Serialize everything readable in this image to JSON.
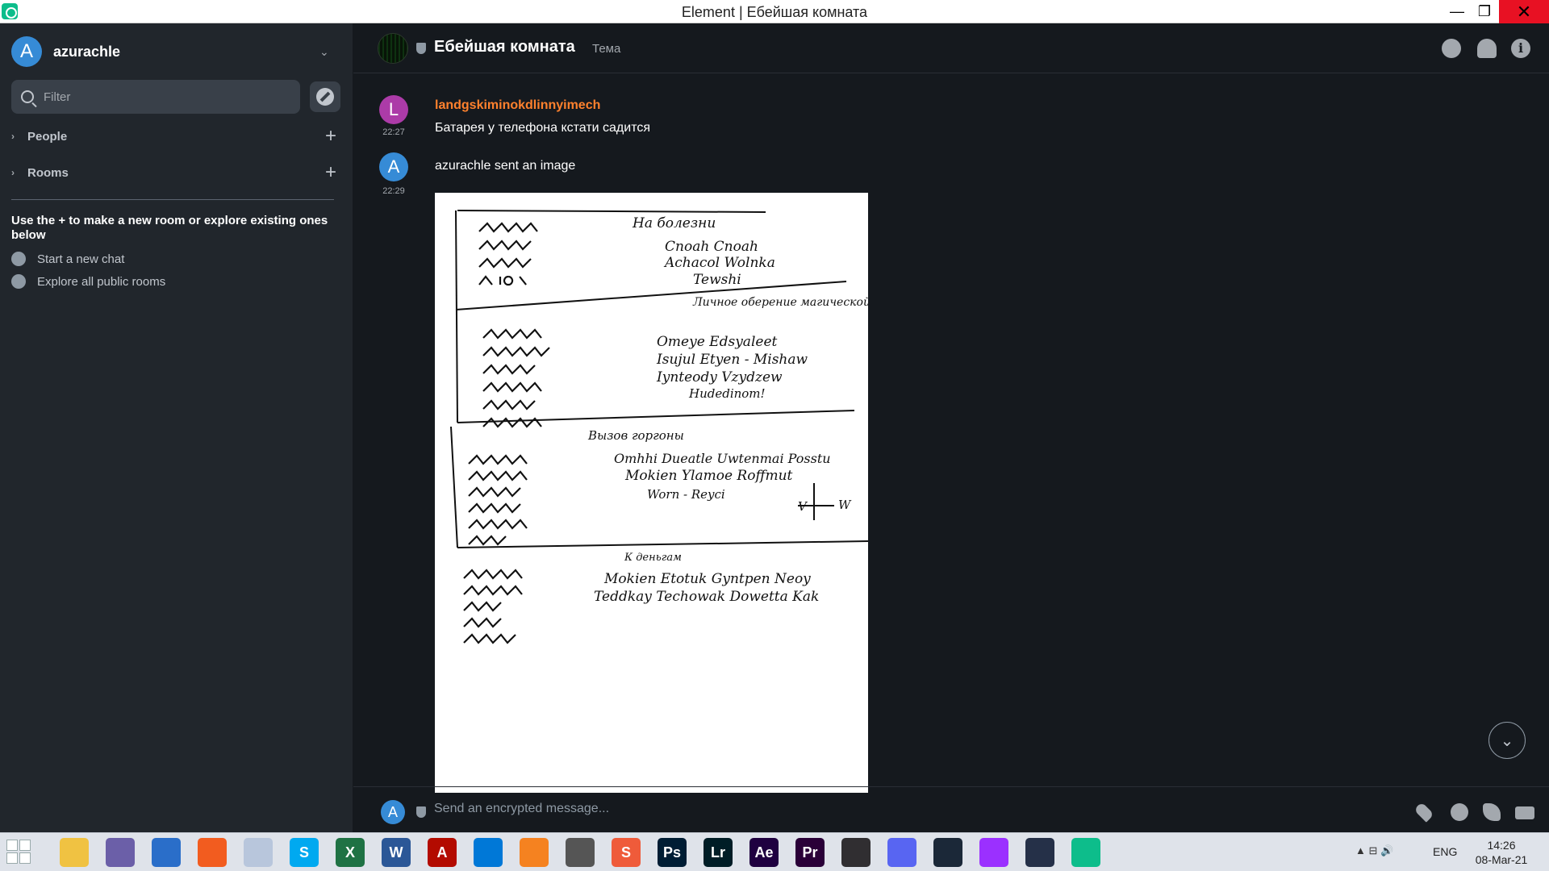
{
  "window": {
    "title": "Element | Ебейшая комната",
    "minimize_glyph": "—",
    "maximize_glyph": "❐",
    "close_glyph": "✕"
  },
  "sidebar": {
    "user": {
      "avatar_letter": "A",
      "name": "azurachle",
      "chevron": "⌄"
    },
    "filter": {
      "placeholder": "Filter",
      "value": ""
    },
    "sections": [
      {
        "label": "People",
        "chevron": "›",
        "add_glyph": "+"
      },
      {
        "label": "Rooms",
        "chevron": "›",
        "add_glyph": "+"
      }
    ],
    "hint": "Use the + to make a new room or explore existing ones below",
    "actions": [
      {
        "label": "Start a new chat",
        "icon": "chat-bubble-icon"
      },
      {
        "label": "Explore all public rooms",
        "icon": "compass-icon"
      }
    ]
  },
  "room": {
    "name": "Ебейшая комната",
    "topic": "Тема",
    "header_icons": [
      "search-icon",
      "bell-icon",
      "info-icon"
    ]
  },
  "messages": [
    {
      "avatar_letter": "L",
      "avatar_color": "#ac3ba8",
      "sender": "landgskiminokdlinnyimech",
      "sender_color": "#ff812d",
      "time": "22:27",
      "body": "Батарея у телефона кстати садится"
    },
    {
      "avatar_letter": "A",
      "avatar_color": "#368bd6",
      "time": "22:29",
      "emote": "azurachle sent an image"
    }
  ],
  "image_text": {
    "section1_title": "На болезни",
    "section1_lines": [
      "Cnoah   Cnoah",
      "Achacol  Wolnka",
      "Tewshi"
    ],
    "section2_title": "Личное оберение магической силы",
    "section2_lines": [
      "Omeye   Edsyaleet",
      "Isujul   Etyen - Mishaw",
      "Iynteody  Vzydzew",
      "Hudedinom!"
    ],
    "section3_title": "Вызов горгоны",
    "section3_lines": [
      "Omhhi   Dueatle   Uwtenmai  Posstu",
      "Mokien   Ylamoe   Roffmut",
      "Worn - Reyci"
    ],
    "section4_title": "К деньгам",
    "section4_lines": [
      "Mokien  Etotuk   Gyntpen  Neoy",
      "Teddkay  Techowak  Dowetta  Kak"
    ],
    "compass_labels": [
      "V",
      "W"
    ]
  },
  "scroll_button": {
    "glyph": "⌄"
  },
  "composer": {
    "avatar_letter": "A",
    "placeholder": "Send an encrypted message...",
    "icons": [
      "attach-icon",
      "emoji-icon",
      "voice-call-icon",
      "video-call-icon"
    ]
  },
  "taskbar": {
    "apps": [
      {
        "name": "file-explorer",
        "label": "",
        "color": "#f0c242"
      },
      {
        "name": "bittorrent",
        "label": "",
        "color": "#6b5fa8"
      },
      {
        "name": "browser",
        "label": "",
        "color": "#2a6ec9"
      },
      {
        "name": "firefox",
        "label": "",
        "color": "#f25c1f"
      },
      {
        "name": "globe",
        "label": "",
        "color": "#b8c6dc"
      },
      {
        "name": "skype",
        "label": "S",
        "color": "#00a9f0"
      },
      {
        "name": "excel",
        "label": "X",
        "color": "#1f7244"
      },
      {
        "name": "word",
        "label": "W",
        "color": "#2b5797"
      },
      {
        "name": "acrobat",
        "label": "A",
        "color": "#b30b00"
      },
      {
        "name": "vscode",
        "label": "",
        "color": "#0078d7"
      },
      {
        "name": "vlc",
        "label": "",
        "color": "#f58220"
      },
      {
        "name": "downloader",
        "label": "",
        "color": "#555555"
      },
      {
        "name": "sublime",
        "label": "S",
        "color": "#ef5b3a"
      },
      {
        "name": "photoshop",
        "label": "Ps",
        "color": "#001d34"
      },
      {
        "name": "lightroom",
        "label": "Lr",
        "color": "#001d26"
      },
      {
        "name": "after-effects",
        "label": "Ae",
        "color": "#1f0040"
      },
      {
        "name": "premiere",
        "label": "Pr",
        "color": "#2a0038"
      },
      {
        "name": "obs",
        "label": "",
        "color": "#302e31"
      },
      {
        "name": "discord",
        "label": "",
        "color": "#5865f2"
      },
      {
        "name": "steam",
        "label": "",
        "color": "#1b2838"
      },
      {
        "name": "cortana",
        "label": "",
        "color": "#9b30ff"
      },
      {
        "name": "lock",
        "label": "",
        "color": "#253048"
      },
      {
        "name": "element",
        "label": "",
        "color": "#0dbd8b"
      }
    ],
    "tray": "▲  ⊟  🔊",
    "language": "ENG",
    "time": "14:26",
    "date": "08-Mar-21"
  }
}
